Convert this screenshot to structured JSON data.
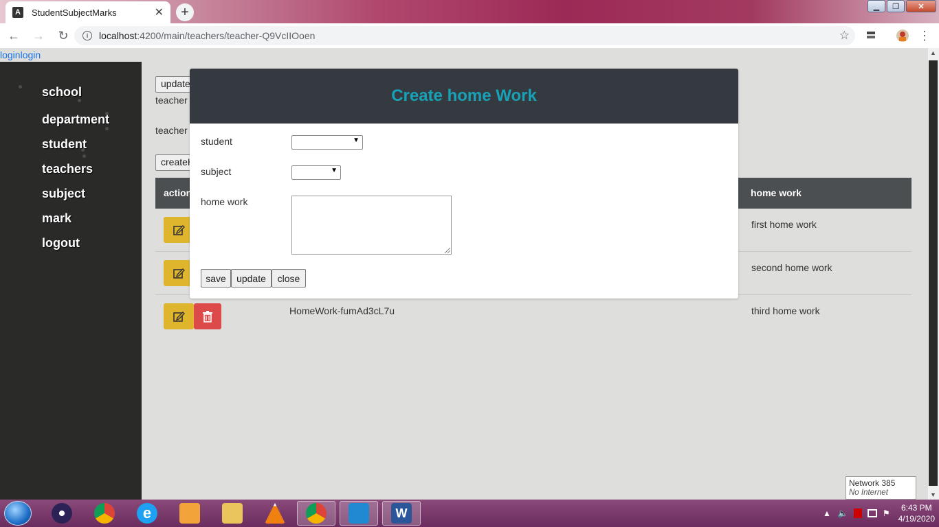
{
  "browser": {
    "tab_title": "StudentSubjectMarks",
    "tab_close": "✕",
    "new_tab": "+",
    "url_host": "localhost",
    "url_path": ":4200/main/teachers/teacher-Q9VcIIOoen"
  },
  "page": {
    "login_link": "loginlogin"
  },
  "sidebar": {
    "items": [
      {
        "label": "school"
      },
      {
        "label": "department"
      },
      {
        "label": "student"
      },
      {
        "label": "teachers"
      },
      {
        "label": "subject"
      },
      {
        "label": "mark"
      },
      {
        "label": "logout"
      }
    ]
  },
  "main": {
    "update_button": "update",
    "teacher_label_1": "teacher",
    "teacher_label_2": "teacher",
    "create_button": "createH",
    "table": {
      "headers": [
        "action",
        "home work"
      ],
      "rows": [
        {
          "id": "",
          "homework": "first home work"
        },
        {
          "id": "",
          "homework": "second home work"
        },
        {
          "id": "HomeWork-fumAd3cL7u",
          "homework": "third home work"
        }
      ]
    }
  },
  "modal": {
    "title": "Create home Work",
    "fields": {
      "student_label": "student",
      "subject_label": "subject",
      "homework_label": "home work"
    },
    "buttons": {
      "save": "save",
      "update": "update",
      "close": "close"
    }
  },
  "network_tooltip": {
    "title": "Network  385",
    "status": "No Internet access"
  },
  "taskbar": {
    "time": "6:43 PM",
    "date": "4/19/2020"
  },
  "colors": {
    "modal_title": "#17a2b8",
    "modal_header": "#343a40",
    "edit_button": "#e0b52e",
    "delete_button": "#dc4a4a",
    "sidebar": "#2a2b29"
  }
}
